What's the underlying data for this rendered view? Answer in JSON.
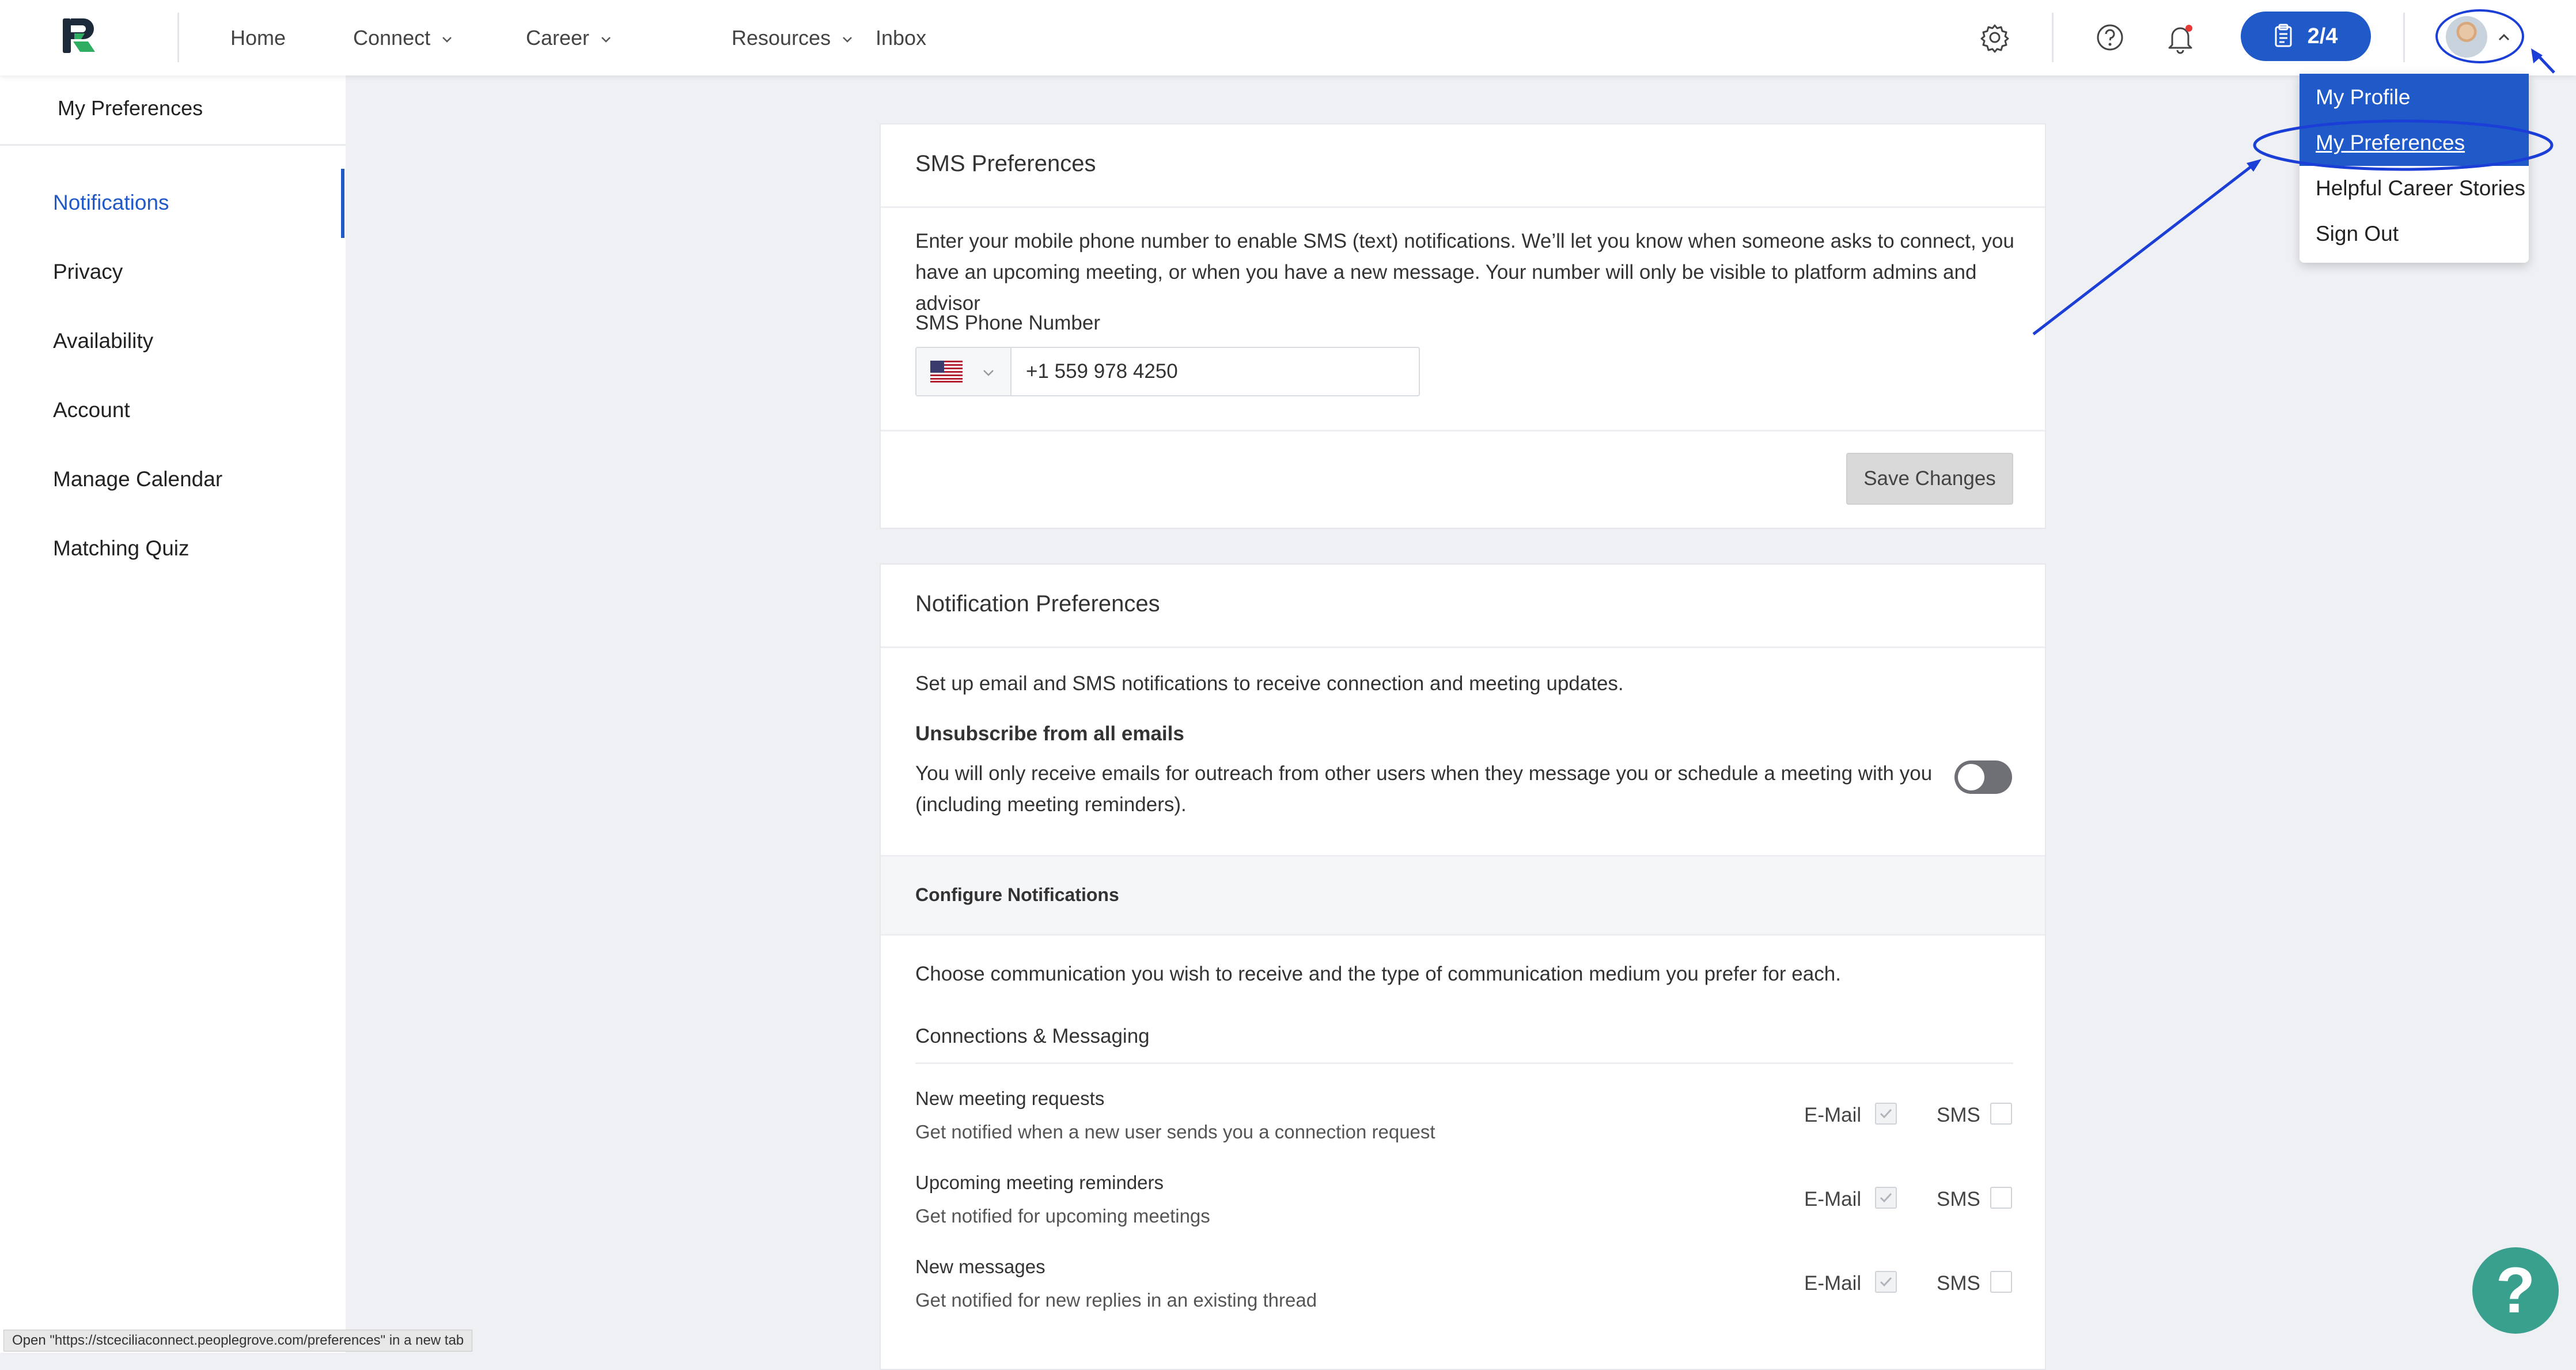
{
  "nav": {
    "items": [
      {
        "label": "Home",
        "dropdown": false
      },
      {
        "label": "Connect",
        "dropdown": true
      },
      {
        "label": "Career",
        "dropdown": true
      },
      {
        "label": "Resources",
        "dropdown": true
      },
      {
        "label": "Inbox",
        "dropdown": false
      }
    ],
    "progress_label": "2/4",
    "icons": [
      "settings-icon",
      "help-circle-icon",
      "bell-icon",
      "clipboard-icon",
      "chevron-up-icon"
    ],
    "accent_color": "#1f5ac8"
  },
  "user_menu": {
    "items": [
      "My Profile",
      "My Preferences",
      "Helpful Career Stories",
      "Sign Out"
    ]
  },
  "sidebar": {
    "title": "My Preferences",
    "items": [
      "Notifications",
      "Privacy",
      "Availability",
      "Account",
      "Manage Calendar",
      "Matching Quiz"
    ],
    "active": "Notifications"
  },
  "sms": {
    "title": "SMS Preferences",
    "desc_line1": "Enter your mobile phone number to enable SMS (text) notifications. We’ll let you know when someone asks to connect, you",
    "desc_line2": "have an upcoming meeting, or when you have a new message. Your number will only be visible to platform admins and advisor",
    "phone_label": "SMS Phone Number",
    "phone_value": "+1 559 978 4250",
    "country_flag": "us-flag-icon",
    "save_label": "Save Changes"
  },
  "notif": {
    "title": "Notification Preferences",
    "intro": "Set up email and SMS notifications to receive connection and meeting updates.",
    "unsub_title": "Unsubscribe from all emails",
    "unsub_line1": "You will only receive emails for outreach from other users when they message you or schedule a meeting with you",
    "unsub_line2": "(including meeting reminders).",
    "unsub_enabled": false,
    "config_title": "Configure Notifications",
    "config_desc": "Choose communication you wish to receive and the type of communication medium you prefer for each.",
    "section_title": "Connections & Messaging",
    "email_label": "E-Mail",
    "sms_label": "SMS",
    "rows": [
      {
        "title": "New meeting requests",
        "desc": "Get notified when a new user sends you a connection request",
        "email": true,
        "sms": false
      },
      {
        "title": "Upcoming meeting reminders",
        "desc": "Get notified for upcoming meetings",
        "email": true,
        "sms": false
      },
      {
        "title": "New messages",
        "desc": "Get notified for new replies in an existing thread",
        "email": true,
        "sms": false
      }
    ]
  },
  "status_bar": {
    "url_text": "Open \"https://stceciliaconnect.peoplegrove.com/preferences\" in a new tab"
  },
  "help_fab": {
    "label": "?"
  }
}
